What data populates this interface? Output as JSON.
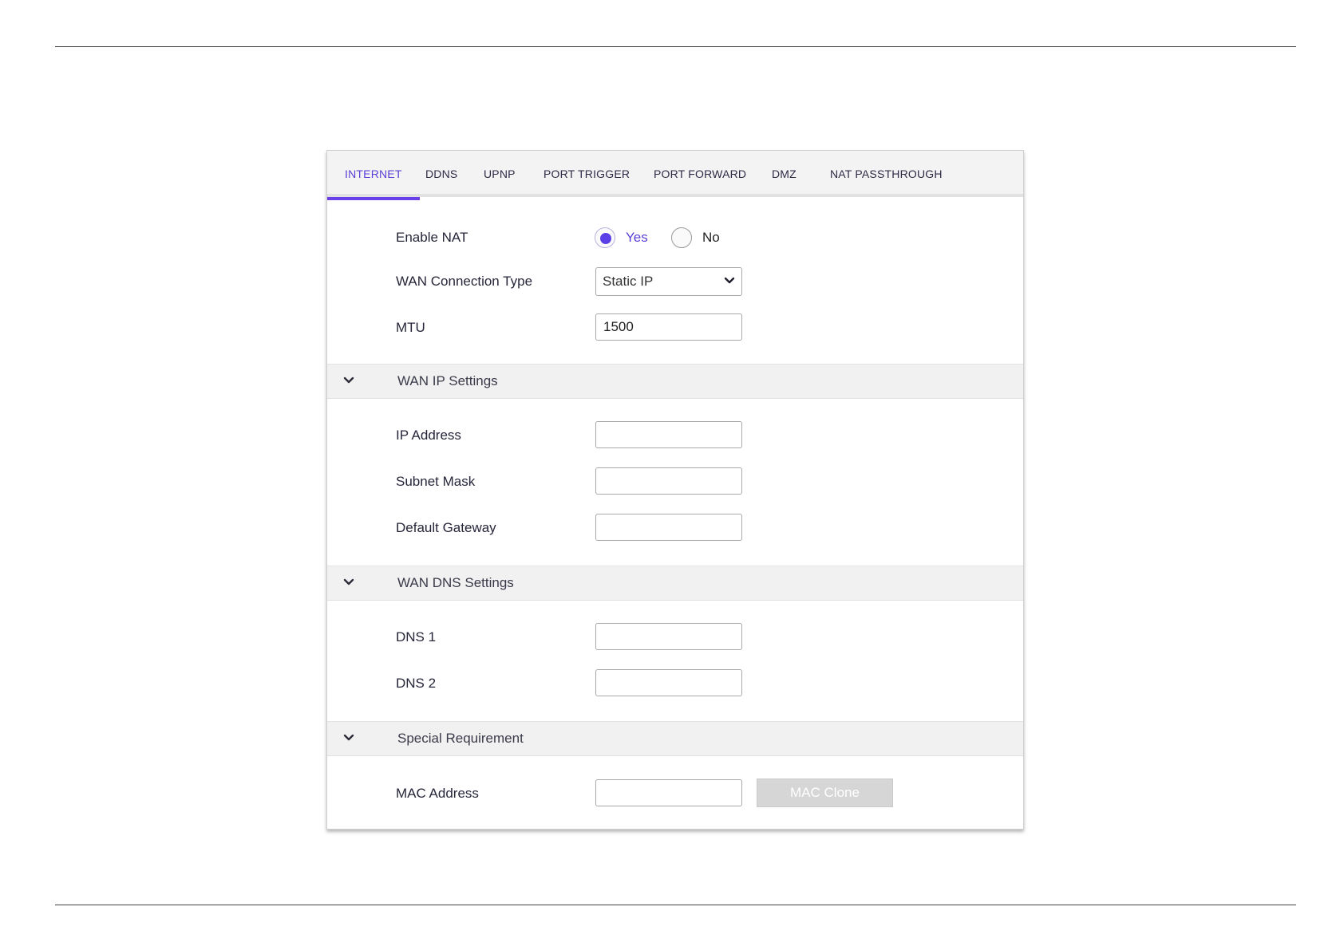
{
  "tabs": [
    {
      "label": "INTERNET",
      "active": true
    },
    {
      "label": "DDNS",
      "active": false
    },
    {
      "label": "UPNP",
      "active": false
    },
    {
      "label": "PORT TRIGGER",
      "active": false
    },
    {
      "label": "PORT FORWARD",
      "active": false
    },
    {
      "label": "DMZ",
      "active": false
    },
    {
      "label": "NAT PASSTHROUGH",
      "active": false
    }
  ],
  "nat": {
    "label": "Enable NAT",
    "options": {
      "yes": "Yes",
      "no": "No"
    },
    "selected": "Yes"
  },
  "wan_type": {
    "label": "WAN Connection Type",
    "value": "Static IP"
  },
  "mtu": {
    "label": "MTU",
    "value": "1500"
  },
  "wan_ip": {
    "title": "WAN IP Settings",
    "ip_label": "IP Address",
    "ip_value": "",
    "subnet_label": "Subnet Mask",
    "subnet_value": "",
    "gateway_label": "Default Gateway",
    "gateway_value": ""
  },
  "wan_dns": {
    "title": "WAN DNS Settings",
    "dns1_label": "DNS 1",
    "dns1_value": "",
    "dns2_label": "DNS 2",
    "dns2_value": ""
  },
  "special": {
    "title": "Special Requirement",
    "mac_label": "MAC Address",
    "mac_value": "",
    "clone_label": "MAC Clone"
  },
  "colors": {
    "accent": "#6a3ee8",
    "radio_dot": "#5b3fe6",
    "section_bg": "#f1f1f1",
    "button_disabled": "#d6d6d6"
  }
}
